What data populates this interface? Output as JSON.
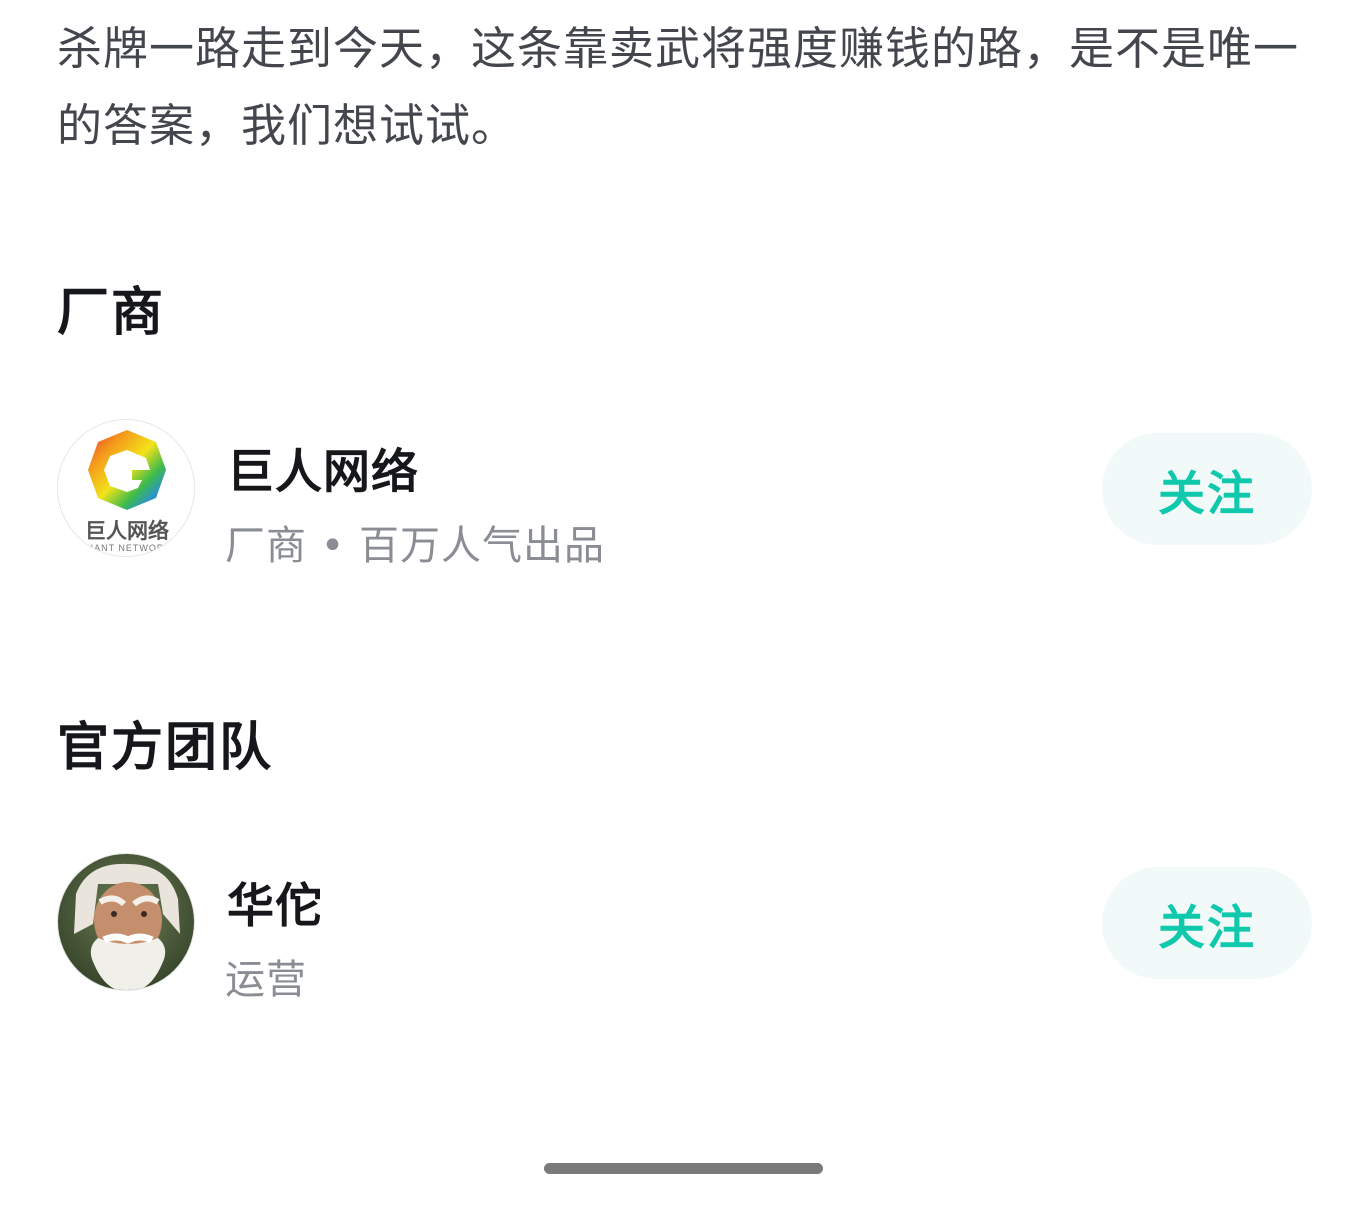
{
  "intro": {
    "text": "杀牌一路走到今天，这条靠卖武将强度赚钱的路，是不是唯一的答案，我们想试试。"
  },
  "sections": {
    "vendor": {
      "title": "厂商",
      "item": {
        "name": "巨人网络",
        "subtitle": "厂商 • 百万人气出品",
        "follow_label": "关注",
        "avatar_icon": "giant-network-logo",
        "logo_text": "巨人网络",
        "logo_subtext": "GIANT NETWORK"
      }
    },
    "team": {
      "title": "官方团队",
      "item": {
        "name": "华佗",
        "subtitle": "运营",
        "follow_label": "关注",
        "avatar_icon": "elder-portrait-avatar"
      }
    }
  },
  "colors": {
    "accent": "#10c9ac",
    "follow_bg": "#f1faf8",
    "text_primary": "#15171a",
    "text_secondary": "#8a8e94",
    "body_text": "#43474d"
  }
}
